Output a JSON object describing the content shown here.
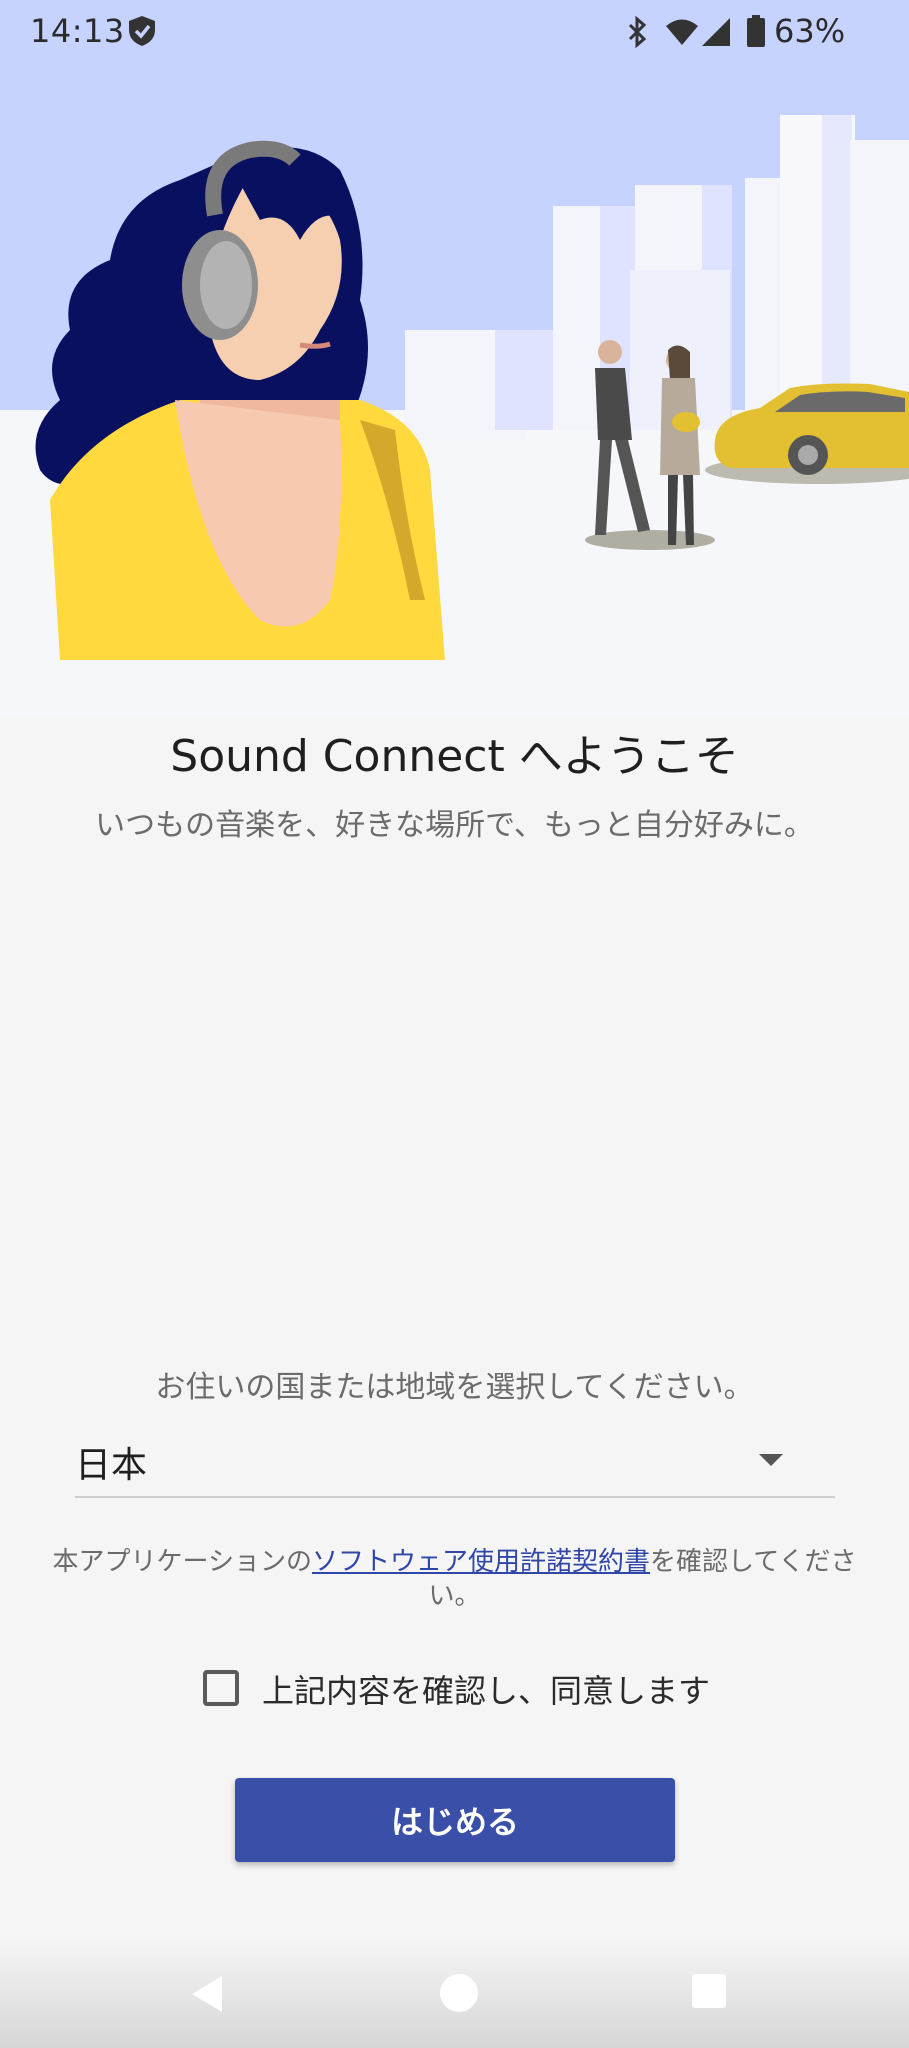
{
  "status_bar": {
    "time": "14:13",
    "battery_percent": "63%",
    "icons": [
      "shield-check-icon",
      "bluetooth-icon",
      "wifi-icon",
      "cell-signal-icon",
      "battery-icon"
    ]
  },
  "hero": {
    "icons": [
      "woman-with-headphones-illustration",
      "city-buildings-illustration",
      "walking-couple-illustration",
      "yellow-car-illustration"
    ]
  },
  "welcome": {
    "title": "Sound Connect へようこそ",
    "subtitle": "いつもの音楽を、好きな場所で、もっと自分好みに。"
  },
  "region": {
    "label": "お住いの国または地域を選択してください。",
    "selected": "日本"
  },
  "license": {
    "prefix": "本アプリケーションの",
    "link_text": "ソフトウェア使用許諾契約書",
    "suffix": "を確認してください。"
  },
  "agreement": {
    "label": "上記内容を確認し、同意します",
    "checked": false
  },
  "start_button": {
    "label": "はじめる"
  },
  "colors": {
    "primary": "#3a4fa8",
    "sky": "#c6d2ff",
    "background": "#f5f5f5",
    "accent_yellow": "#ffd93d",
    "hair_navy": "#0a1060"
  }
}
